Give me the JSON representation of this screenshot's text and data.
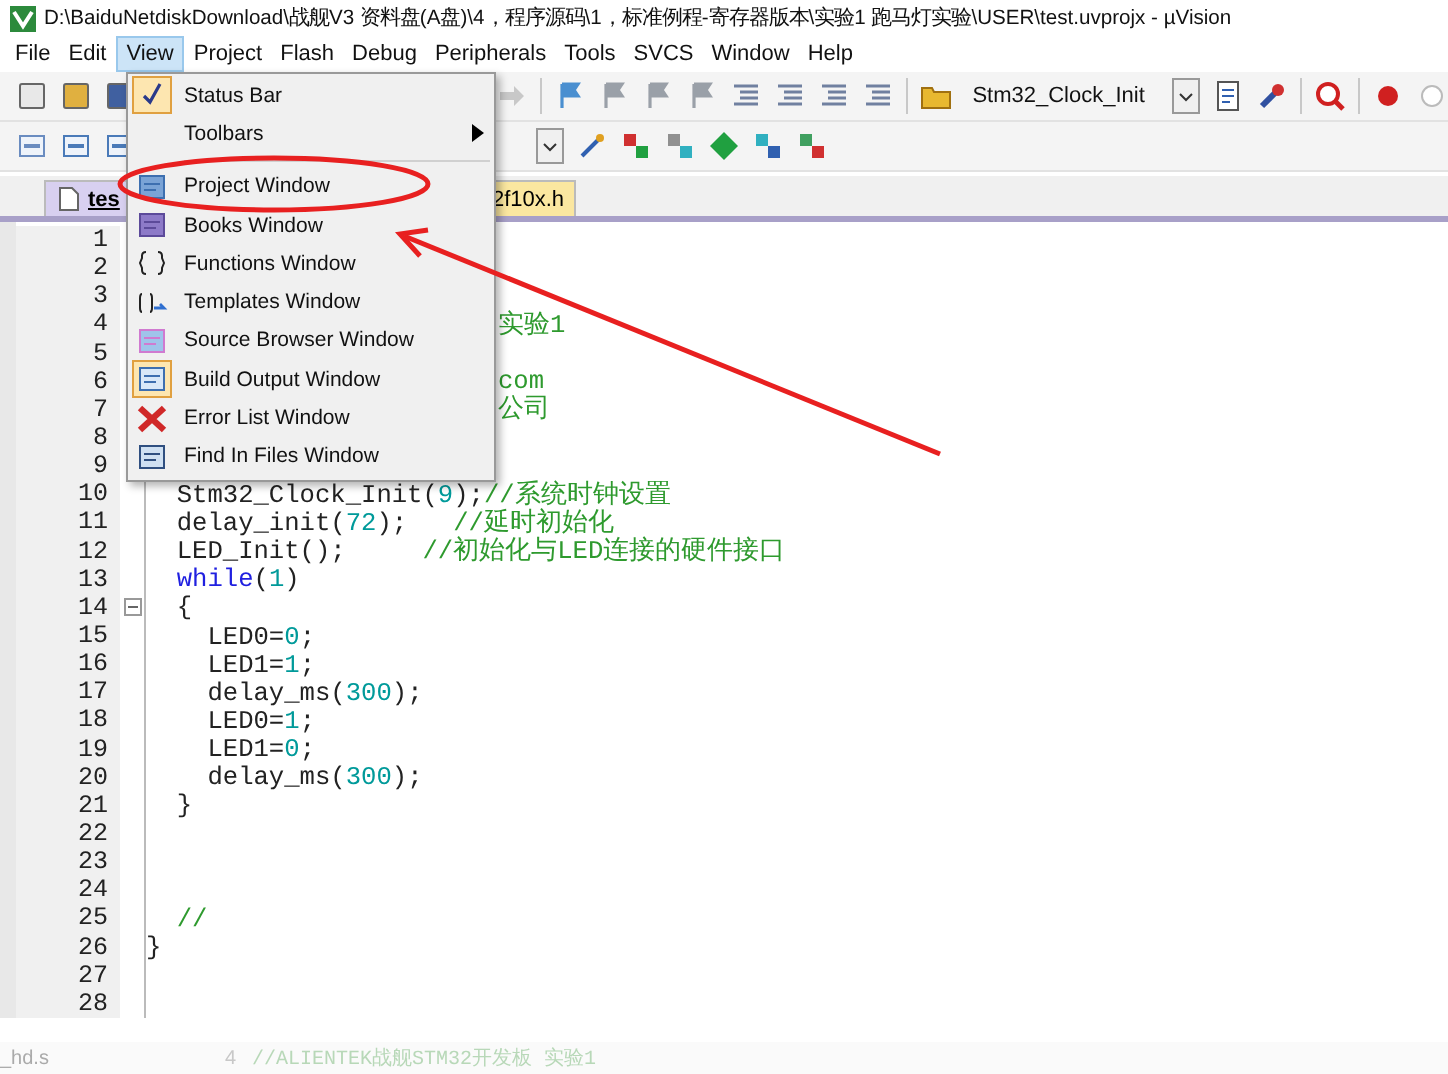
{
  "window": {
    "title": "D:\\BaiduNetdiskDownload\\战舰V3 资料盘(A盘)\\4，程序源码\\1，标准例程-寄存器版本\\实验1 跑马灯实验\\USER\\test.uvprojx - µVision"
  },
  "menu_bar": [
    {
      "label": "File",
      "selected": false
    },
    {
      "label": "Edit",
      "selected": false
    },
    {
      "label": "View",
      "selected": true
    },
    {
      "label": "Project",
      "selected": false
    },
    {
      "label": "Flash",
      "selected": false
    },
    {
      "label": "Debug",
      "selected": false
    },
    {
      "label": "Peripherals",
      "selected": false
    },
    {
      "label": "Tools",
      "selected": false
    },
    {
      "label": "SVCS",
      "selected": false
    },
    {
      "label": "Window",
      "selected": false
    },
    {
      "label": "Help",
      "selected": false
    }
  ],
  "toolbar": {
    "target_combo": "Stm32_Clock_Init"
  },
  "view_menu": {
    "groups": [
      [
        {
          "label": "Status Bar",
          "kind": "check",
          "checked": true
        },
        {
          "label": "Toolbars",
          "kind": "submenu",
          "checked": false
        }
      ],
      [
        {
          "label": "Project Window",
          "kind": "project",
          "checked": false
        },
        {
          "label": "Books Window",
          "kind": "books",
          "checked": false
        },
        {
          "label": "Functions Window",
          "kind": "functions",
          "checked": false
        },
        {
          "label": "Templates Window",
          "kind": "templates",
          "checked": false
        },
        {
          "label": "Source Browser Window",
          "kind": "browser",
          "checked": false
        },
        {
          "label": "Build Output Window",
          "kind": "output",
          "checked": true
        },
        {
          "label": "Error List Window",
          "kind": "errors",
          "checked": false
        },
        {
          "label": "Find In Files Window",
          "kind": "find",
          "checked": false
        }
      ]
    ]
  },
  "editor_tabs": [
    {
      "label": "tes",
      "selected": true
    },
    {
      "label": "2f10x.h",
      "selected": false
    }
  ],
  "code_lines": [
    {
      "number": "1",
      "kind": "partial"
    },
    {
      "number": "2",
      "kind": "partial"
    },
    {
      "number": "3",
      "kind": "partial"
    },
    {
      "number": "4",
      "kind": "partial",
      "segments": [
        {
          "kind": "comment",
          "text": "实验1"
        }
      ]
    },
    {
      "number": "5",
      "kind": "partial"
    },
    {
      "number": "6",
      "kind": "partial",
      "segments": [
        {
          "kind": "comment",
          "text": "com"
        }
      ]
    },
    {
      "number": "7",
      "kind": "partial",
      "segments": [
        {
          "kind": "comment",
          "text": "公司"
        }
      ]
    },
    {
      "number": "8",
      "kind": "partial"
    },
    {
      "number": "9",
      "kind": "partial"
    },
    {
      "number": "10",
      "kind": "text",
      "segments": [
        {
          "kind": "plain",
          "text": "  Stm32_Clock_Init("
        },
        {
          "kind": "number",
          "text": "9"
        },
        {
          "kind": "plain",
          "text": ");"
        },
        {
          "kind": "comment",
          "text": "//系统时钟设置"
        }
      ]
    },
    {
      "number": "11",
      "kind": "text",
      "segments": [
        {
          "kind": "plain",
          "text": "  delay_init("
        },
        {
          "kind": "number",
          "text": "72"
        },
        {
          "kind": "plain",
          "text": ");   "
        },
        {
          "kind": "comment",
          "text": "//延时初始化"
        }
      ]
    },
    {
      "number": "12",
      "kind": "text",
      "segments": [
        {
          "kind": "plain",
          "text": "  LED_Init();     "
        },
        {
          "kind": "comment",
          "text": "//初始化与LED连接的硬件接口"
        }
      ]
    },
    {
      "number": "13",
      "kind": "text",
      "segments": [
        {
          "kind": "keyword",
          "text": "  while"
        },
        {
          "kind": "plain",
          "text": "("
        },
        {
          "kind": "number",
          "text": "1"
        },
        {
          "kind": "plain",
          "text": ")"
        }
      ]
    },
    {
      "number": "14",
      "kind": "fold",
      "segments": [
        {
          "kind": "plain",
          "text": "  {"
        }
      ]
    },
    {
      "number": "15",
      "kind": "text",
      "segments": [
        {
          "kind": "plain",
          "text": "    LED0="
        },
        {
          "kind": "number",
          "text": "0"
        },
        {
          "kind": "plain",
          "text": ";"
        }
      ]
    },
    {
      "number": "16",
      "kind": "text",
      "segments": [
        {
          "kind": "plain",
          "text": "    LED1="
        },
        {
          "kind": "number",
          "text": "1"
        },
        {
          "kind": "plain",
          "text": ";"
        }
      ]
    },
    {
      "number": "17",
      "kind": "text",
      "segments": [
        {
          "kind": "plain",
          "text": "    delay_ms("
        },
        {
          "kind": "number",
          "text": "300"
        },
        {
          "kind": "plain",
          "text": ");"
        }
      ]
    },
    {
      "number": "18",
      "kind": "text",
      "segments": [
        {
          "kind": "plain",
          "text": "    LED0="
        },
        {
          "kind": "number",
          "text": "1"
        },
        {
          "kind": "plain",
          "text": ";"
        }
      ]
    },
    {
      "number": "19",
      "kind": "text",
      "segments": [
        {
          "kind": "plain",
          "text": "    LED1="
        },
        {
          "kind": "number",
          "text": "0"
        },
        {
          "kind": "plain",
          "text": ";"
        }
      ]
    },
    {
      "number": "20",
      "kind": "text",
      "segments": [
        {
          "kind": "plain",
          "text": "    delay_ms("
        },
        {
          "kind": "number",
          "text": "300"
        },
        {
          "kind": "plain",
          "text": ");"
        }
      ]
    },
    {
      "number": "21",
      "kind": "text",
      "segments": [
        {
          "kind": "plain",
          "text": "  }"
        }
      ]
    },
    {
      "number": "22",
      "kind": "text"
    },
    {
      "number": "23",
      "kind": "text"
    },
    {
      "number": "24",
      "kind": "text"
    },
    {
      "number": "25",
      "kind": "text",
      "segments": [
        {
          "kind": "comment",
          "text": "  //"
        }
      ]
    },
    {
      "number": "26",
      "kind": "text",
      "segments": [
        {
          "kind": "plain",
          "text": "}"
        }
      ]
    },
    {
      "number": "27",
      "kind": "text"
    },
    {
      "number": "28",
      "kind": "text"
    }
  ],
  "ghost_panel": {
    "file": "_hd.s",
    "line_number": "4",
    "text": "//ALIENTEK战舰STM32开发板 实验1"
  }
}
